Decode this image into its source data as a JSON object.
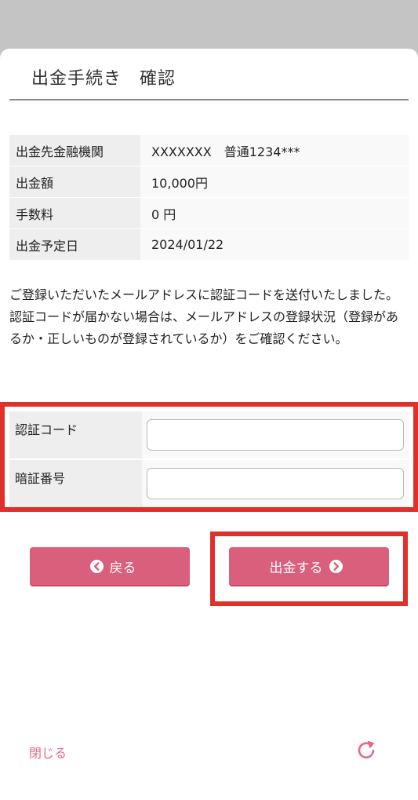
{
  "page": {
    "title": "出金手続き　確認"
  },
  "details": [
    {
      "label": "出金先金融機関",
      "value": "XXXXXXX　普通1234***"
    },
    {
      "label": "出金額",
      "value": "10,000円"
    },
    {
      "label": "手数料",
      "value": "0 円"
    },
    {
      "label": "出金予定日",
      "value": "2024/01/22"
    }
  ],
  "notice": {
    "line1": "ご登録いただいたメールアドレスに認証コードを送付いたしました。",
    "line2": "認証コードが届かない場合は、メールアドレスの登録状況（登録があるか・正しいものが登録されているか）をご確認ください。"
  },
  "form": {
    "auth_code": {
      "label": "認証コード",
      "value": ""
    },
    "pin": {
      "label": "暗証番号",
      "value": ""
    }
  },
  "buttons": {
    "back_label": "戻る",
    "submit_label": "出金する"
  },
  "footer": {
    "close_label": "閉じる"
  },
  "colors": {
    "button": "#d95f7c",
    "highlight": "#e0302a",
    "link": "#e06a86"
  },
  "icons": {
    "back": "chevron-left-circle-icon",
    "submit": "chevron-right-circle-icon",
    "reload": "reload-icon"
  }
}
